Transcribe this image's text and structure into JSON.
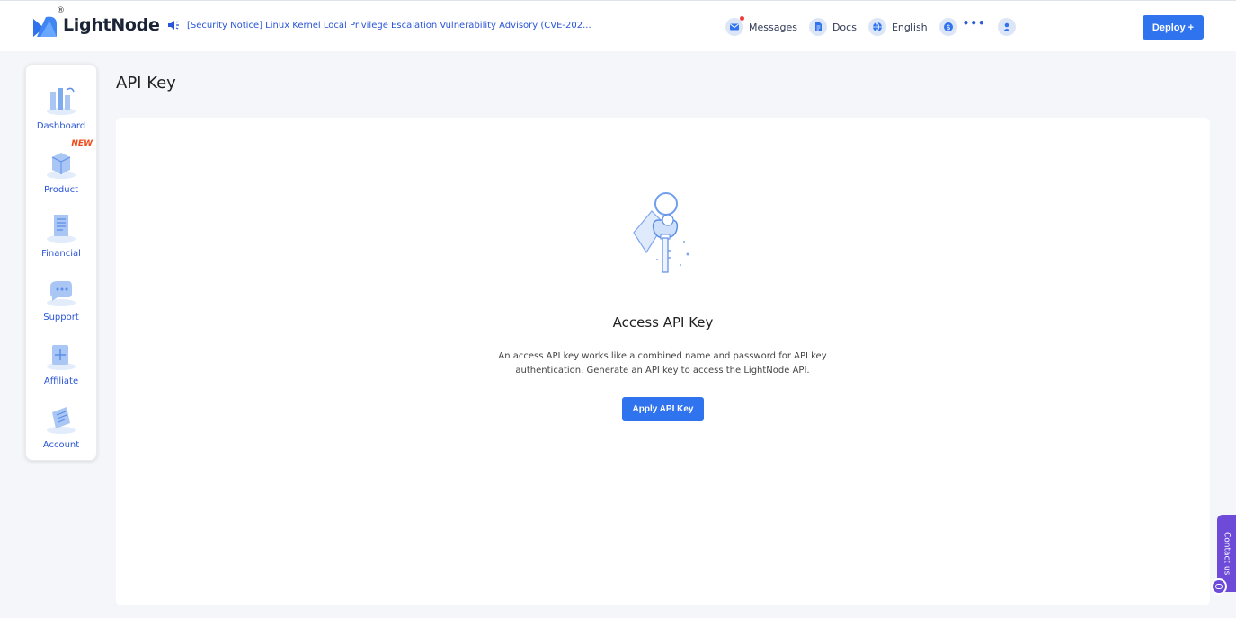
{
  "header": {
    "logo_text": "LightNode",
    "logo_reg": "®",
    "notice": "[Security Notice] Linux Kernel Local Privilege Escalation Vulnerability Advisory (CVE-202...",
    "messages_label": "Messages",
    "docs_label": "Docs",
    "language_label": "English",
    "balance_label": "•••",
    "deploy_label": "Deploy +"
  },
  "sidebar": {
    "items": [
      {
        "label": "Dashboard",
        "icon": "dashboard-icon"
      },
      {
        "label": "Product",
        "icon": "product-icon",
        "badge": "NEW"
      },
      {
        "label": "Financial",
        "icon": "financial-icon"
      },
      {
        "label": "Support",
        "icon": "support-icon"
      },
      {
        "label": "Affiliate",
        "icon": "affiliate-icon"
      },
      {
        "label": "Account",
        "icon": "account-icon"
      }
    ]
  },
  "main": {
    "page_title": "API Key",
    "card_title": "Access API Key",
    "card_desc_line1": "An access API key works like a combined name and password for API key",
    "card_desc_line2": "authentication. Generate an API key to access the LightNode API.",
    "apply_label": "Apply API Key"
  },
  "contact": {
    "label": "Contact us"
  },
  "colors": {
    "accent": "#2f73ee",
    "link": "#2a55d6",
    "contact": "#6d4ad8",
    "new_badge": "#f04a1c"
  }
}
